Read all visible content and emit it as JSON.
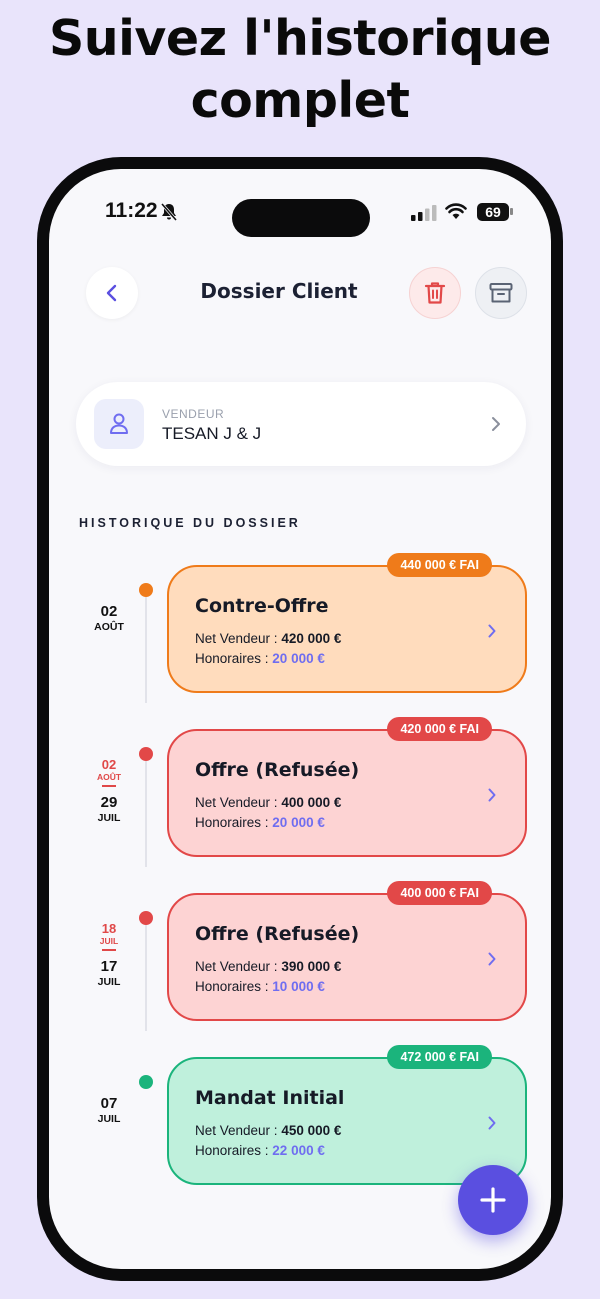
{
  "headline": {
    "line1": "Suivez l'historique",
    "line2": "complet"
  },
  "status_bar": {
    "time": "11:22",
    "battery": "69"
  },
  "header": {
    "title": "Dossier Client"
  },
  "seller": {
    "role": "VENDEUR",
    "name": "TESAN J & J"
  },
  "history": {
    "title": "HISTORIQUE DU DOSSIER",
    "labels": {
      "net": "Net Vendeur : ",
      "fees": "Honoraires : "
    },
    "entries": [
      {
        "day": "02",
        "month": "AOÛT",
        "prev_day": "",
        "prev_month": "",
        "title": "Contre-Offre",
        "net": "420 000 €",
        "fees": "20 000 €",
        "badge": "440 000 € FAI",
        "status": "counter-offer"
      },
      {
        "day": "29",
        "month": "JUIL",
        "prev_day": "02",
        "prev_month": "AOÛT",
        "title": "Offre (Refusée)",
        "net": "400 000 €",
        "fees": "20 000 €",
        "badge": "420 000 € FAI",
        "status": "refused"
      },
      {
        "day": "17",
        "month": "JUIL",
        "prev_day": "18",
        "prev_month": "JUIL",
        "title": "Offre (Refusée)",
        "net": "390 000 €",
        "fees": "10 000 €",
        "badge": "400 000 € FAI",
        "status": "refused"
      },
      {
        "day": "07",
        "month": "JUIL",
        "prev_day": "",
        "prev_month": "",
        "title": "Mandat Initial",
        "net": "450 000 €",
        "fees": "22 000 €",
        "badge": "472 000 € FAI",
        "status": "initial"
      }
    ]
  },
  "colors": {
    "accent": "#5a4fe0",
    "counter_offer": "#ef7b1a",
    "refused": "#e24848",
    "initial": "#1bb47c",
    "counter_offer_bg": "#ffdcbd",
    "refused_bg": "#fdd3d3",
    "initial_bg": "#bff0dc"
  },
  "icons": {
    "back": "chevron-left-icon",
    "delete": "trash-icon",
    "archive": "archive-box-icon",
    "seller": "user-icon",
    "add": "plus-icon"
  }
}
